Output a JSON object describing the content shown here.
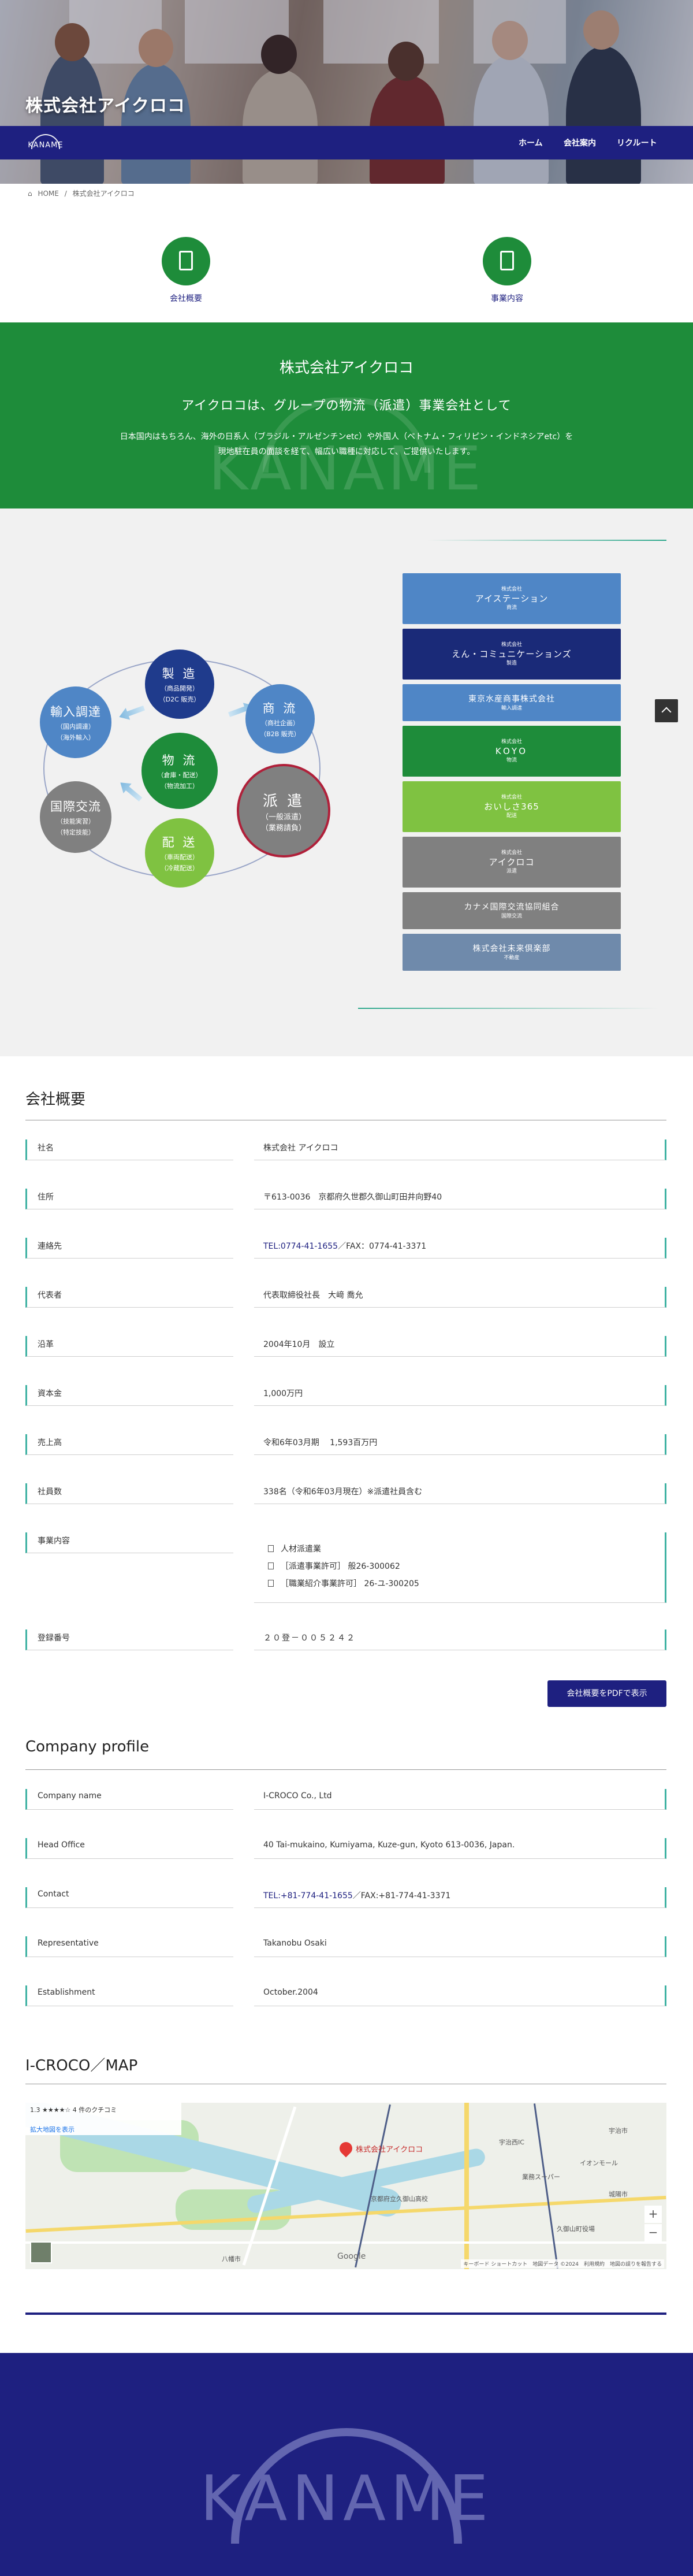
{
  "hero": {
    "title": "株式会社アイクロコ"
  },
  "nav": {
    "logo": "KANAME",
    "items": [
      "ホーム",
      "会社案内",
      "リクルート"
    ]
  },
  "breadcrumb": {
    "home": "HOME",
    "sep": "/",
    "current": "株式会社アイクロコ"
  },
  "quick_links": [
    {
      "label": "会社概要",
      "icon": "building-icon"
    },
    {
      "label": "事業内容",
      "icon": "document-icon"
    }
  ],
  "intro": {
    "title": "株式会社アイクロコ",
    "subtitle": "アイクロコは、グループの物流（派遣）事業会社として",
    "line1": "日本国内はもちろん、海外の日系人（ブラジル・アルゼンチンetc）や外国人（ベトナム・フィリピン・インドネシアetc）を",
    "line2": "現地駐在員の面談を経て、幅広い職種に対応して、ご提供いたします。",
    "watermark": "KANAME"
  },
  "diagram": {
    "nodes": [
      {
        "id": "manufacture",
        "title": "製 造",
        "sub1": "（商品開発）",
        "sub2": "（D2C 販売）",
        "color": "#1f3b8c"
      },
      {
        "id": "commerce",
        "title": "商 流",
        "sub1": "（商社企画）",
        "sub2": "（B2B 販売）",
        "color": "#4f86c6"
      },
      {
        "id": "dispatch",
        "title": "派 遣",
        "sub1": "（一般派遣）",
        "sub2": "（業務請負）",
        "color": "#808080"
      },
      {
        "id": "delivery",
        "title": "配 送",
        "sub1": "（車両配送）",
        "sub2": "（冷蔵配送）",
        "color": "#7fc241"
      },
      {
        "id": "exchange",
        "title": "国際交流",
        "sub1": "（技能実習）",
        "sub2": "（特定技能）",
        "color": "#808080"
      },
      {
        "id": "import",
        "title": "輸入調達",
        "sub1": "（国内調達）",
        "sub2": "（海外輸入）",
        "color": "#4f86c6"
      },
      {
        "id": "logistics",
        "title": "物 流",
        "sub1": "（倉庫・配送）",
        "sub2": "（物流加工）",
        "color": "#1e8c3a"
      }
    ]
  },
  "companies": [
    {
      "prefix": "株式会社",
      "name": "アイステーション",
      "tag": "商流",
      "color": "#4f86c6"
    },
    {
      "prefix": "株式会社",
      "name": "えん・コミュニケーションズ",
      "tag": "製造",
      "color": "#1a2a78"
    },
    {
      "prefix": "",
      "name": "東京水産商事株式会社",
      "tag": "輸入調達",
      "color": "#4f86c6"
    },
    {
      "prefix": "株式会社",
      "name": "KOYO",
      "tag": "物流",
      "color": "#1e8c3a"
    },
    {
      "prefix": "株式会社",
      "name": "おいしさ365",
      "tag": "配送",
      "color": "#7fc241"
    },
    {
      "prefix": "株式会社",
      "name": "アイクロコ",
      "tag": "派遣",
      "color": "#808080"
    },
    {
      "prefix": "",
      "name": "カナメ国際交流協同組合",
      "tag": "国際交流",
      "color": "#808080"
    },
    {
      "prefix": "",
      "name": "株式会社未来倶楽部",
      "tag": "不動産",
      "color": "#6f8aab"
    }
  ],
  "overview": {
    "title": "会社概要",
    "rows": [
      {
        "label": "社名",
        "value": "株式会社 アイクロコ"
      },
      {
        "label": "住所",
        "value": "〒613-0036　京都府久世郡久御山町田井向野40"
      },
      {
        "label": "連絡先",
        "value_link": "TEL:0774-41-1655",
        "value": "／FAX：0774-41-3371"
      },
      {
        "label": "代表者",
        "value": "代表取締役社長　大﨑 喬允"
      },
      {
        "label": "沿革",
        "value": "2004年10月　設立"
      },
      {
        "label": "資本金",
        "value": "1,000万円"
      },
      {
        "label": "売上高",
        "value": "令和6年03月期　 1,593百万円"
      },
      {
        "label": "社員数",
        "value": "338名（令和6年03月現在）※派遣社員含む"
      },
      {
        "label": "事業内容",
        "items": [
          "人材派遣業",
          "［派遣事業許可］ 般26-300062",
          "［職業紹介事業許可］ 26-ユ-300205"
        ]
      },
      {
        "label": "登録番号",
        "value": "２０登－００５２４２"
      }
    ],
    "pdf_button": "会社概要をPDFで表示"
  },
  "profile": {
    "title": "Company profile",
    "rows": [
      {
        "label": "Company name",
        "value": "I-CROCO Co., Ltd"
      },
      {
        "label": "Head Office",
        "value": "40 Tai-mukaino, Kumiyama, Kuze-gun, Kyoto 613-0036, Japan."
      },
      {
        "label": "Contact",
        "value_link": "TEL:+81-774-41-1655",
        "value": "／FAX:+81-774-41-3371"
      },
      {
        "label": "Representative",
        "value": "Takanobu Osaki"
      },
      {
        "label": "Establishment",
        "value": "October.2004"
      }
    ]
  },
  "map": {
    "title": "I-CROCO／MAP",
    "info_rating": "1.3 ★★★★☆ 4 件のクチコミ",
    "info_link": "拡大地図を表示",
    "pin_label": "株式会社アイクロコ",
    "labels": [
      "八幡市",
      "京都府立久御山高校",
      "久御山町役場",
      "業務スーパー",
      "イオンモール",
      "宇治西IC",
      "城陽市",
      "宇治市"
    ],
    "google": "Google",
    "attribution": "キーボード ショートカット　地図データ ©2024　利用規約　地図の誤りを報告する",
    "zoom_in": "+",
    "zoom_out": "−"
  },
  "footer": {
    "logo": "KANAME"
  }
}
